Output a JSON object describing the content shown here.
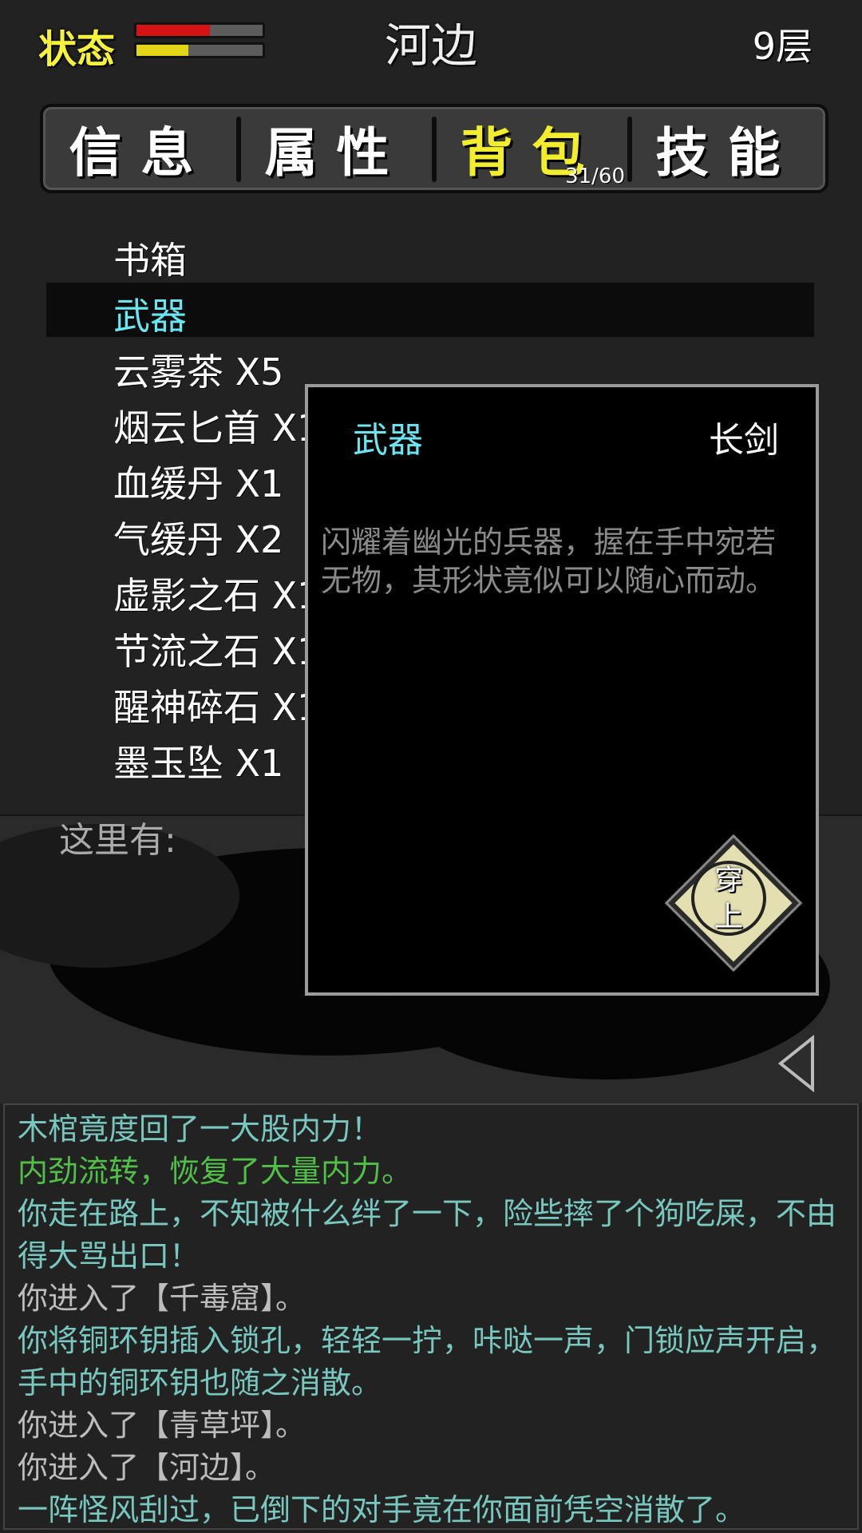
{
  "header": {
    "status_label": "状态",
    "hp_level": 0.58,
    "mp_level": 0.41,
    "location": "河边",
    "floor": "9层"
  },
  "tabs": [
    {
      "label": "信息",
      "active": false
    },
    {
      "label": "属性",
      "active": false
    },
    {
      "label": "背包",
      "active": true,
      "count": "31/60"
    },
    {
      "label": "技能",
      "active": false
    }
  ],
  "inventory": {
    "items": [
      "书箱",
      "武器",
      "云雾茶 X5",
      "烟云匕首 X1",
      "血缓丹 X1",
      "气缓丹 X2",
      "虚影之石 X1",
      "节流之石 X1",
      "醒神碎石 X1",
      "墨玉坠 X1"
    ],
    "selected_index": 1
  },
  "here_label": "这里有:",
  "detail": {
    "category": "武器",
    "name": "长剑",
    "description": "闪耀着幽光的兵器，握在手中宛若无物，其形状竟似可以随心而动。",
    "equip_line1": "穿",
    "equip_line2": "上"
  },
  "log": [
    {
      "text": "木棺竟度回了一大股内力！",
      "color": "#78c8c0"
    },
    {
      "text": "内劲流转，恢复了大量内力。",
      "color": "#52c048"
    },
    {
      "text": "你走在路上，不知被什么绊了一下，险些摔了个狗吃屎，不由得大骂出口！",
      "color": "#78c8c0"
    },
    {
      "text": "你进入了【千毒窟】。",
      "color": "#bdbdbd"
    },
    {
      "text": "你将铜环钥插入锁孔，轻轻一拧，咔哒一声，门锁应声开启，手中的铜环钥也随之消散。",
      "color": "#78c8c0"
    },
    {
      "text": "你进入了【青草坪】。",
      "color": "#bdbdbd"
    },
    {
      "text": "你进入了【河边】。",
      "color": "#bdbdbd"
    },
    {
      "text": "一阵怪风刮过，已倒下的对手竟在你面前凭空消散了。",
      "color": "#78c8c0"
    }
  ]
}
